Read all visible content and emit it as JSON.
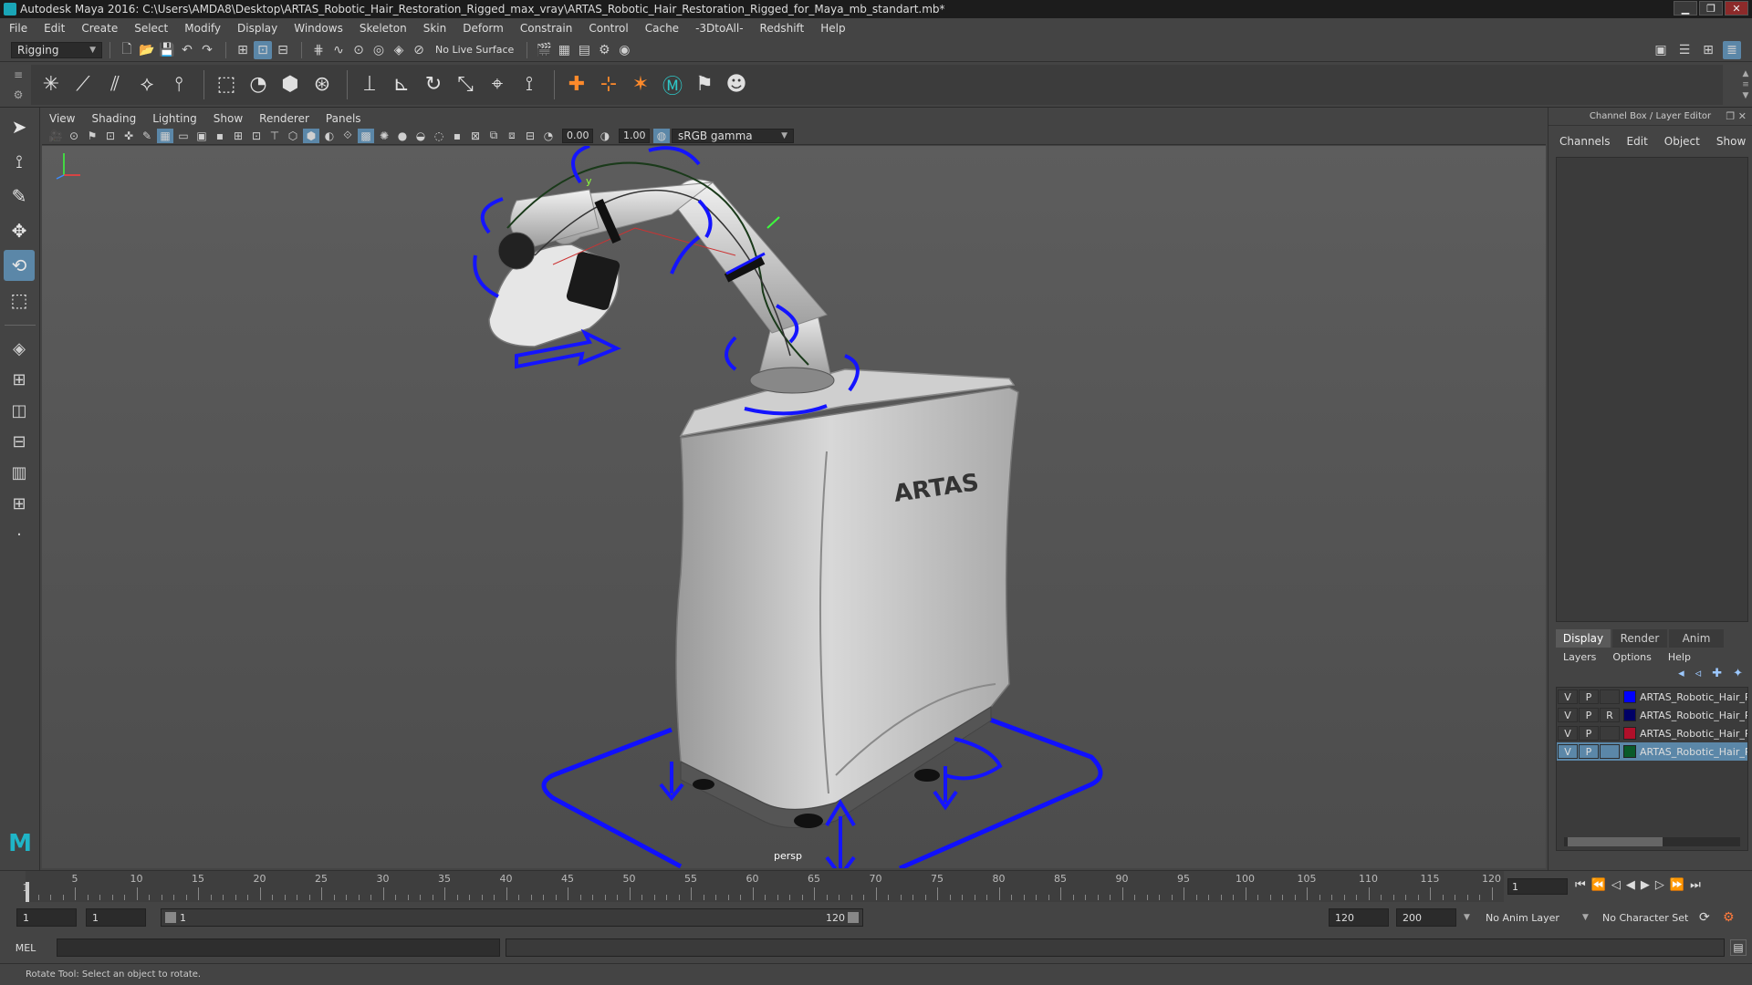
{
  "window": {
    "title": "Autodesk Maya 2016: C:\\Users\\AMDA8\\Desktop\\ARTAS_Robotic_Hair_Restoration_Rigged_max_vray\\ARTAS_Robotic_Hair_Restoration_Rigged_for_Maya_mb_standart.mb*",
    "minimize": "▁",
    "maximize": "❐",
    "close": "✕"
  },
  "menubar": [
    "File",
    "Edit",
    "Create",
    "Select",
    "Modify",
    "Display",
    "Windows",
    "Skeleton",
    "Skin",
    "Deform",
    "Constrain",
    "Control",
    "Cache",
    "-3DtoAll-",
    "Redshift",
    "Help"
  ],
  "statusline": {
    "menuset": "Rigging",
    "live_surface": "No Live Surface"
  },
  "viewport": {
    "menus": [
      "View",
      "Shading",
      "Lighting",
      "Show",
      "Renderer",
      "Panels"
    ],
    "exposure": "0.00",
    "gamma": "1.00",
    "color_space": "sRGB gamma",
    "camera": "persp",
    "model_brand": "ARTAS"
  },
  "channelbox": {
    "title": "Channel Box / Layer Editor",
    "menus": [
      "Channels",
      "Edit",
      "Object",
      "Show"
    ],
    "layer_tabs": [
      "Display",
      "Render",
      "Anim"
    ],
    "layer_menus": [
      "Layers",
      "Options",
      "Help"
    ],
    "layers": [
      {
        "v": "V",
        "p": "P",
        "r": "",
        "color": "#0000ff",
        "name": "ARTAS_Robotic_Hair_R",
        "selected": false
      },
      {
        "v": "V",
        "p": "P",
        "r": "R",
        "color": "#000066",
        "name": "ARTAS_Robotic_Hair_R",
        "selected": false
      },
      {
        "v": "V",
        "p": "P",
        "r": "",
        "color": "#b0102a",
        "name": "ARTAS_Robotic_Hair_R",
        "selected": false
      },
      {
        "v": "V",
        "p": "P",
        "r": "",
        "color": "#0a5a2a",
        "name": "ARTAS_Robotic_Hair_R",
        "selected": true
      }
    ]
  },
  "timeline": {
    "ticks": [
      5,
      10,
      15,
      20,
      25,
      30,
      35,
      40,
      45,
      50,
      55,
      60,
      65,
      70,
      75,
      80,
      85,
      90,
      95,
      100,
      105,
      110,
      115,
      120
    ],
    "start_label": "1",
    "current_frame": "1"
  },
  "range": {
    "start_field": "1",
    "playback_start": "1",
    "slider_start": "1",
    "slider_end": "120",
    "playback_end": "120",
    "end_field": "200",
    "anim_layer": "No Anim Layer",
    "character_set": "No Character Set"
  },
  "cmdline": {
    "mode": "MEL"
  },
  "helpline": {
    "text": "Rotate Tool: Select an object to rotate."
  }
}
